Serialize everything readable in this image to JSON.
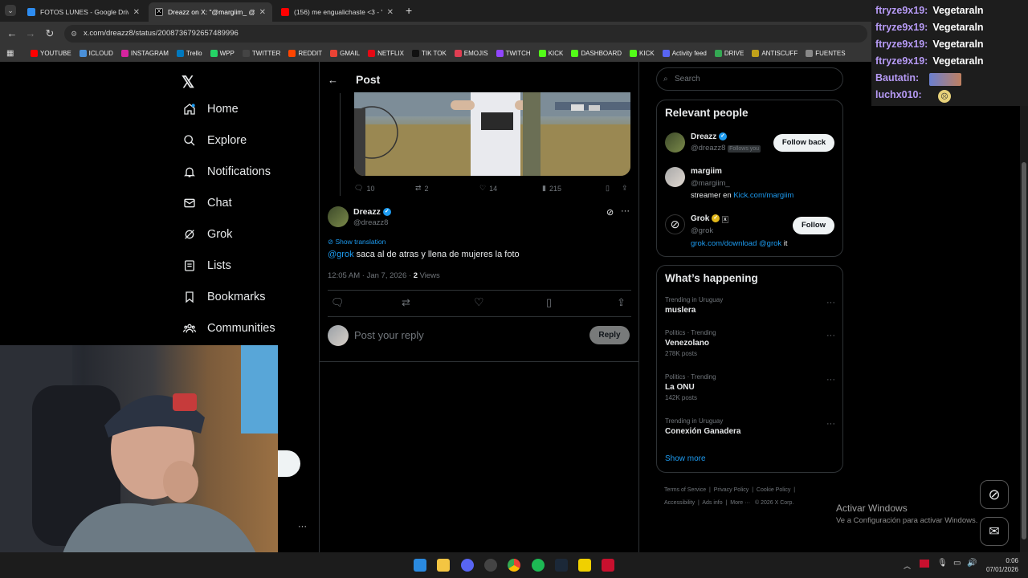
{
  "tabs": [
    {
      "title": "FOTOS LUNES - Google Drive",
      "color": "#2d8cf0"
    },
    {
      "title": "Dreazz on X: \"@margiim_ @gro",
      "color": "#ffffff"
    },
    {
      "title": "(156) me engualichaste <3 - You",
      "color": "#ff0000"
    }
  ],
  "url": "x.com/dreazz8/status/2008736792657489996",
  "bookmarks": [
    {
      "label": "YOUTUBE",
      "color": "#ff0000"
    },
    {
      "label": "ICLOUD",
      "color": "#4a90d9"
    },
    {
      "label": "INSTAGRAM",
      "color": "#d6249f"
    },
    {
      "label": "Trello",
      "color": "#0079bf"
    },
    {
      "label": "WPP",
      "color": "#25d366"
    },
    {
      "label": "TWITTER",
      "color": "#444444"
    },
    {
      "label": "REDDIT",
      "color": "#ff4500"
    },
    {
      "label": "GMAIL",
      "color": "#ea4335"
    },
    {
      "label": "NETFLIX",
      "color": "#e50914"
    },
    {
      "label": "TIK TOK",
      "color": "#111111"
    },
    {
      "label": "EMOJIS",
      "color": "#e03e52"
    },
    {
      "label": "TWITCH",
      "color": "#9146ff"
    },
    {
      "label": "KICK",
      "color": "#53fc18"
    },
    {
      "label": "DASHBOARD",
      "color": "#53fc18"
    },
    {
      "label": "KICK",
      "color": "#53fc18"
    },
    {
      "label": "Activity feed",
      "color": "#5865f2"
    },
    {
      "label": "DRIVE",
      "color": "#34a853"
    },
    {
      "label": "ANTISCUFF",
      "color": "#c1a11a"
    },
    {
      "label": "FUENTES",
      "color": "#888888"
    }
  ],
  "sidebar": {
    "items": [
      {
        "label": "Home",
        "icon": "home-icon"
      },
      {
        "label": "Explore",
        "icon": "search-icon"
      },
      {
        "label": "Notifications",
        "icon": "bell-icon"
      },
      {
        "label": "Chat",
        "icon": "mail-icon"
      },
      {
        "label": "Grok",
        "icon": "grok-icon"
      },
      {
        "label": "Lists",
        "icon": "lists-icon"
      },
      {
        "label": "Bookmarks",
        "icon": "bookmark-icon"
      },
      {
        "label": "Communities",
        "icon": "communities-icon"
      }
    ]
  },
  "post": {
    "header": "Post",
    "prev_stats": {
      "replies": "10",
      "reposts": "2",
      "likes": "14",
      "views": "215"
    },
    "author_name": "Dreazz",
    "author_handle": "@dreazz8",
    "show_translation": "Show translation",
    "mention": "@grok",
    "text": " saca al de atras y llena de mujeres la foto",
    "time": "12:05 AM · Jan 7, 2026 · ",
    "views_count": "2",
    "views_label": " Views",
    "reply_placeholder": "Post your reply",
    "reply_button": "Reply"
  },
  "search_placeholder": "Search",
  "relevant": {
    "title": "Relevant people",
    "people": [
      {
        "name": "Dreazz",
        "handle": "@dreazz8",
        "follows_you": "Follows you",
        "button": "Follow back"
      },
      {
        "name": "margiim",
        "handle": "@margiim_",
        "bio": "streamer en ",
        "bio_link": "Kick.com/margiim"
      },
      {
        "name": "Grok",
        "handle": "@grok",
        "bio_link": "grok.com/download",
        "bio_mention": "@grok",
        "bio_end": " it",
        "button": "Follow"
      }
    ]
  },
  "happening": {
    "title": "What’s happening",
    "trends": [
      {
        "meta": "Trending in Uruguay",
        "name": "muslera",
        "posts": ""
      },
      {
        "meta": "Politics · Trending",
        "name": "Venezolano",
        "posts": "278K posts"
      },
      {
        "meta": "Politics · Trending",
        "name": "La ONU",
        "posts": "142K posts"
      },
      {
        "meta": "Trending in Uruguay",
        "name": "Conexión Ganadera",
        "posts": ""
      }
    ],
    "show_more": "Show more"
  },
  "footer": [
    "Terms of Service",
    "Privacy Policy",
    "Cookie Policy",
    "Accessibility",
    "Ads info",
    "More ···",
    "© 2026 X Corp."
  ],
  "chat_overlay": [
    {
      "user": "ftryze9x19:",
      "msg": "Vegetaraln"
    },
    {
      "user": "ftryze9x19:",
      "msg": "Vegetaraln"
    },
    {
      "user": "ftryze9x19:",
      "msg": "Vegetaraln"
    },
    {
      "user": "ftryze9x19:",
      "msg": "Vegetaraln"
    },
    {
      "user": "Bautatin:",
      "msg": ""
    },
    {
      "user": "luchx010:",
      "msg": ""
    }
  ],
  "activate_windows": {
    "title": "Activar Windows",
    "sub": "Ve a Configuración para activar Windows."
  },
  "clock": {
    "time": "0:06",
    "date": "07/01/2026"
  }
}
